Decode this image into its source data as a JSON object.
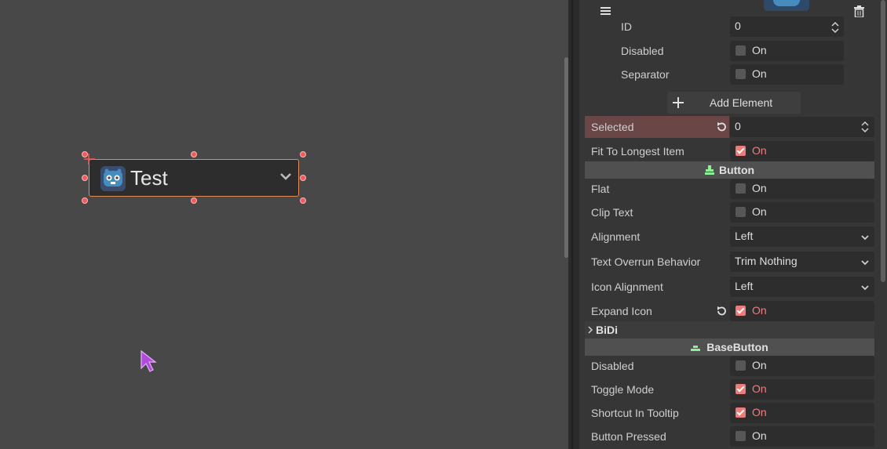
{
  "preview": {
    "button_text": "Test"
  },
  "popup_item": {
    "id_label": "ID",
    "id_value": "0",
    "disabled_label": "Disabled",
    "disabled_value": "On",
    "separator_label": "Separator",
    "separator_value": "On",
    "add_element_label": "Add Element"
  },
  "option_button": {
    "selected_label": "Selected",
    "selected_value": "0",
    "fit_label": "Fit To Longest Item",
    "fit_value": "On"
  },
  "button_section": {
    "title": "Button",
    "flat_label": "Flat",
    "flat_value": "On",
    "clip_label": "Clip Text",
    "clip_value": "On",
    "alignment_label": "Alignment",
    "alignment_value": "Left",
    "overrun_label": "Text Overrun Behavior",
    "overrun_value": "Trim Nothing",
    "icon_alignment_label": "Icon Alignment",
    "icon_alignment_value": "Left",
    "expand_icon_label": "Expand Icon",
    "expand_icon_value": "On",
    "bidi_label": "BiDi"
  },
  "base_button_section": {
    "title": "BaseButton",
    "disabled_label": "Disabled",
    "disabled_value": "On",
    "toggle_label": "Toggle Mode",
    "toggle_value": "On",
    "shortcut_label": "Shortcut In Tooltip",
    "shortcut_value": "On",
    "pressed_label": "Button Pressed",
    "pressed_value": "On"
  },
  "colors": {
    "accent": "#ec7b7b",
    "selection": "#e38c57",
    "section_icon": "#8eef97"
  }
}
